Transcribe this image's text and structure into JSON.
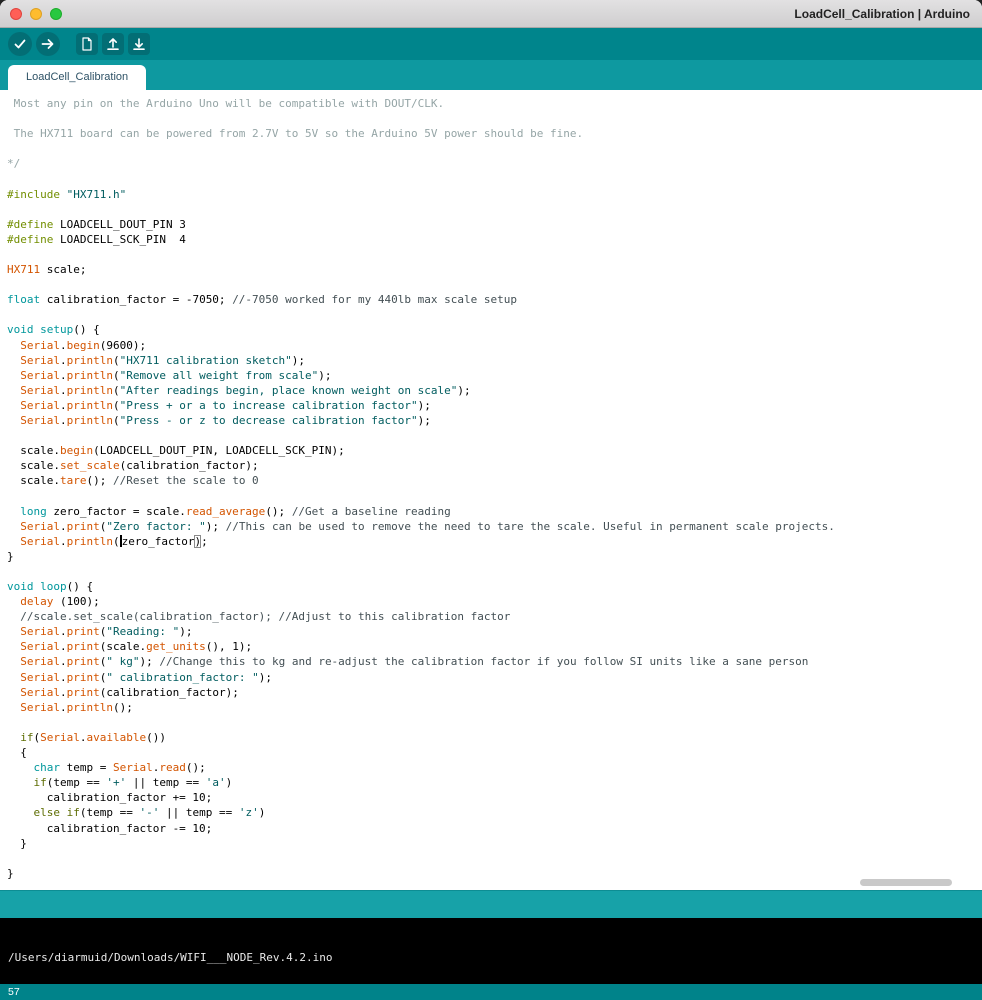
{
  "window": {
    "title": "LoadCell_Calibration | Arduino"
  },
  "toolbar": {
    "buttons": [
      {
        "name": "verify",
        "shape": "circle"
      },
      {
        "name": "upload",
        "shape": "circle"
      },
      {
        "name": "new-sketch",
        "shape": "square",
        "group_start": true
      },
      {
        "name": "open",
        "shape": "square"
      },
      {
        "name": "save",
        "shape": "square"
      }
    ]
  },
  "tab": {
    "label": "LoadCell_Calibration"
  },
  "editor": {
    "lines": [
      [
        [
          " Most any pin on the Arduino Uno will be compatible with DOUT/CLK.",
          "c1"
        ]
      ],
      [],
      [
        [
          " The HX711 board can be powered from 2.7V to 5V so the Arduino 5V power should be fine.",
          "c1"
        ]
      ],
      [],
      [
        [
          "*/",
          "c1"
        ]
      ],
      [],
      [
        [
          "#include",
          "p"
        ],
        [
          " ",
          "d"
        ],
        [
          "\"HX711.h\"",
          "s"
        ]
      ],
      [],
      [
        [
          "#define",
          "p"
        ],
        [
          " LOADCELL_DOUT_PIN 3",
          "d"
        ]
      ],
      [
        [
          "#define",
          "p"
        ],
        [
          " LOADCELL_SCK_PIN  4",
          "d"
        ]
      ],
      [],
      [
        [
          "HX711",
          "f"
        ],
        [
          " scale;",
          "d"
        ]
      ],
      [],
      [
        [
          "float",
          "k"
        ],
        [
          " calibration_factor = -7050; ",
          "d"
        ],
        [
          "//-7050 worked for my 440lb max scale setup",
          "c2"
        ]
      ],
      [],
      [
        [
          "void",
          "k"
        ],
        [
          " ",
          "d"
        ],
        [
          "setup",
          "k"
        ],
        [
          "() {",
          "d"
        ]
      ],
      [
        [
          "  ",
          "d"
        ],
        [
          "Serial",
          "f"
        ],
        [
          ".",
          "d"
        ],
        [
          "begin",
          "f"
        ],
        [
          "(9600);",
          "d"
        ]
      ],
      [
        [
          "  ",
          "d"
        ],
        [
          "Serial",
          "f"
        ],
        [
          ".",
          "d"
        ],
        [
          "println",
          "f"
        ],
        [
          "(",
          "d"
        ],
        [
          "\"HX711 calibration sketch\"",
          "s"
        ],
        [
          ");",
          "d"
        ]
      ],
      [
        [
          "  ",
          "d"
        ],
        [
          "Serial",
          "f"
        ],
        [
          ".",
          "d"
        ],
        [
          "println",
          "f"
        ],
        [
          "(",
          "d"
        ],
        [
          "\"Remove all weight from scale\"",
          "s"
        ],
        [
          ");",
          "d"
        ]
      ],
      [
        [
          "  ",
          "d"
        ],
        [
          "Serial",
          "f"
        ],
        [
          ".",
          "d"
        ],
        [
          "println",
          "f"
        ],
        [
          "(",
          "d"
        ],
        [
          "\"After readings begin, place known weight on scale\"",
          "s"
        ],
        [
          ");",
          "d"
        ]
      ],
      [
        [
          "  ",
          "d"
        ],
        [
          "Serial",
          "f"
        ],
        [
          ".",
          "d"
        ],
        [
          "println",
          "f"
        ],
        [
          "(",
          "d"
        ],
        [
          "\"Press + or a to increase calibration factor\"",
          "s"
        ],
        [
          ");",
          "d"
        ]
      ],
      [
        [
          "  ",
          "d"
        ],
        [
          "Serial",
          "f"
        ],
        [
          ".",
          "d"
        ],
        [
          "println",
          "f"
        ],
        [
          "(",
          "d"
        ],
        [
          "\"Press - or z to decrease calibration factor\"",
          "s"
        ],
        [
          ");",
          "d"
        ]
      ],
      [],
      [
        [
          "  scale.",
          "d"
        ],
        [
          "begin",
          "f"
        ],
        [
          "(LOADCELL_DOUT_PIN, LOADCELL_SCK_PIN);",
          "d"
        ]
      ],
      [
        [
          "  scale.",
          "d"
        ],
        [
          "set_scale",
          "f"
        ],
        [
          "(calibration_factor);",
          "d"
        ]
      ],
      [
        [
          "  scale.",
          "d"
        ],
        [
          "tare",
          "f"
        ],
        [
          "(); ",
          "d"
        ],
        [
          "//Reset the scale to 0",
          "c2"
        ]
      ],
      [],
      [
        [
          "  ",
          "d"
        ],
        [
          "long",
          "k"
        ],
        [
          " zero_factor = scale.",
          "d"
        ],
        [
          "read_average",
          "f"
        ],
        [
          "(); ",
          "d"
        ],
        [
          "//Get a baseline reading",
          "c2"
        ]
      ],
      [
        [
          "  ",
          "d"
        ],
        [
          "Serial",
          "f"
        ],
        [
          ".",
          "d"
        ],
        [
          "print",
          "f"
        ],
        [
          "(",
          "d"
        ],
        [
          "\"Zero factor: \"",
          "s"
        ],
        [
          "); ",
          "d"
        ],
        [
          "//This can be used to remove the need to tare the scale. Useful in permanent scale projects.",
          "c2"
        ]
      ],
      [
        [
          "  ",
          "d"
        ],
        [
          "Serial",
          "f"
        ],
        [
          ".",
          "d"
        ],
        [
          "println",
          "f"
        ],
        [
          "(",
          "d"
        ],
        [
          "",
          "caret"
        ],
        [
          "zero_factor",
          "d"
        ],
        [
          ")",
          "box"
        ],
        [
          ";",
          "d"
        ]
      ],
      [
        [
          "}",
          "d"
        ]
      ],
      [],
      [
        [
          "void",
          "k"
        ],
        [
          " ",
          "d"
        ],
        [
          "loop",
          "k"
        ],
        [
          "() {",
          "d"
        ]
      ],
      [
        [
          "  ",
          "d"
        ],
        [
          "delay",
          "f"
        ],
        [
          " (100);",
          "d"
        ]
      ],
      [
        [
          "  ",
          "d"
        ],
        [
          "//scale.set_scale(calibration_factor); //Adjust to this calibration factor",
          "c2"
        ]
      ],
      [
        [
          "  ",
          "d"
        ],
        [
          "Serial",
          "f"
        ],
        [
          ".",
          "d"
        ],
        [
          "print",
          "f"
        ],
        [
          "(",
          "d"
        ],
        [
          "\"Reading: \"",
          "s"
        ],
        [
          ");",
          "d"
        ]
      ],
      [
        [
          "  ",
          "d"
        ],
        [
          "Serial",
          "f"
        ],
        [
          ".",
          "d"
        ],
        [
          "print",
          "f"
        ],
        [
          "(scale.",
          "d"
        ],
        [
          "get_units",
          "f"
        ],
        [
          "(), 1);",
          "d"
        ]
      ],
      [
        [
          "  ",
          "d"
        ],
        [
          "Serial",
          "f"
        ],
        [
          ".",
          "d"
        ],
        [
          "print",
          "f"
        ],
        [
          "(",
          "d"
        ],
        [
          "\" kg\"",
          "s"
        ],
        [
          "); ",
          "d"
        ],
        [
          "//Change this to kg and re-adjust the calibration factor if you follow SI units like a sane person",
          "c2"
        ]
      ],
      [
        [
          "  ",
          "d"
        ],
        [
          "Serial",
          "f"
        ],
        [
          ".",
          "d"
        ],
        [
          "print",
          "f"
        ],
        [
          "(",
          "d"
        ],
        [
          "\" calibration_factor: \"",
          "s"
        ],
        [
          ");",
          "d"
        ]
      ],
      [
        [
          "  ",
          "d"
        ],
        [
          "Serial",
          "f"
        ],
        [
          ".",
          "d"
        ],
        [
          "print",
          "f"
        ],
        [
          "(calibration_factor);",
          "d"
        ]
      ],
      [
        [
          "  ",
          "d"
        ],
        [
          "Serial",
          "f"
        ],
        [
          ".",
          "d"
        ],
        [
          "println",
          "f"
        ],
        [
          "();",
          "d"
        ]
      ],
      [],
      [
        [
          "  ",
          "d"
        ],
        [
          "if",
          "kc"
        ],
        [
          "(",
          "d"
        ],
        [
          "Serial",
          "f"
        ],
        [
          ".",
          "d"
        ],
        [
          "available",
          "f"
        ],
        [
          "())",
          "d"
        ]
      ],
      [
        [
          "  {",
          "d"
        ]
      ],
      [
        [
          "    ",
          "d"
        ],
        [
          "char",
          "k"
        ],
        [
          " temp = ",
          "d"
        ],
        [
          "Serial",
          "f"
        ],
        [
          ".",
          "d"
        ],
        [
          "read",
          "f"
        ],
        [
          "();",
          "d"
        ]
      ],
      [
        [
          "    ",
          "d"
        ],
        [
          "if",
          "kc"
        ],
        [
          "(temp == ",
          "d"
        ],
        [
          "'+'",
          "s"
        ],
        [
          " || temp == ",
          "d"
        ],
        [
          "'a'",
          "s"
        ],
        [
          ")",
          "d"
        ]
      ],
      [
        [
          "      calibration_factor += 10;",
          "d"
        ]
      ],
      [
        [
          "    ",
          "d"
        ],
        [
          "else",
          "kc"
        ],
        [
          " ",
          "d"
        ],
        [
          "if",
          "kc"
        ],
        [
          "(temp == ",
          "d"
        ],
        [
          "'-'",
          "s"
        ],
        [
          " || temp == ",
          "d"
        ],
        [
          "'z'",
          "s"
        ],
        [
          ")",
          "d"
        ]
      ],
      [
        [
          "      calibration_factor -= 10;",
          "d"
        ]
      ],
      [
        [
          "  }",
          "d"
        ]
      ],
      [],
      [
        [
          "}",
          "d"
        ]
      ]
    ]
  },
  "console": {
    "path": "/Users/diarmuid/Downloads/WIFI___NODE_Rev.4.2.ino"
  },
  "statusbar": {
    "line": "57"
  },
  "colors": {
    "toolbar_teal": "#00858C",
    "tabbar_teal": "#0E99A0",
    "strip_teal": "#17A2A8",
    "bottombar_teal": "#00838A",
    "keyword": "#00979C",
    "function": "#D35400",
    "string": "#005C5F",
    "preprocessor": "#728E00",
    "control": "#5E6D03",
    "comment_block": "#95a5a6",
    "comment_line": "#434f54",
    "console_bg": "#000000"
  }
}
